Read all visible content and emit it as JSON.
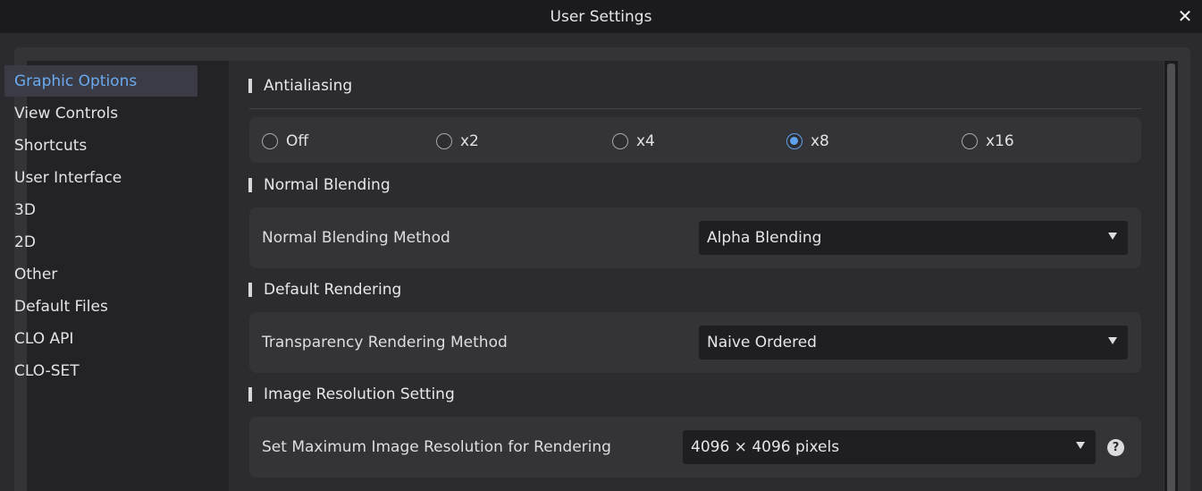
{
  "window": {
    "title": "User Settings",
    "close_glyph": "✕"
  },
  "sidebar": {
    "items": [
      {
        "label": "Graphic Options",
        "active": true
      },
      {
        "label": "View Controls"
      },
      {
        "label": "Shortcuts"
      },
      {
        "label": "User Interface"
      },
      {
        "label": "3D"
      },
      {
        "label": "2D"
      },
      {
        "label": "Other"
      },
      {
        "label": "Default Files"
      },
      {
        "label": "CLO API"
      },
      {
        "label": "CLO-SET"
      }
    ]
  },
  "antialiasing": {
    "title": "Antialiasing",
    "options": [
      "Off",
      "x2",
      "x4",
      "x8",
      "x16"
    ],
    "selected": "x8"
  },
  "normal_blending": {
    "title": "Normal Blending",
    "label": "Normal Blending Method",
    "value": "Alpha Blending"
  },
  "default_rendering": {
    "title": "Default Rendering",
    "label": "Transparency Rendering Method",
    "value": "Naive Ordered"
  },
  "image_resolution": {
    "title": "Image Resolution Setting",
    "label": "Set Maximum Image Resolution for Rendering",
    "value": "4096 × 4096 pixels",
    "help_glyph": "?"
  },
  "colors": {
    "accent": "#5ea2ee",
    "active_text": "#6aaaf0"
  },
  "icons": [
    "close-icon",
    "chevron-down-icon",
    "help-icon"
  ]
}
